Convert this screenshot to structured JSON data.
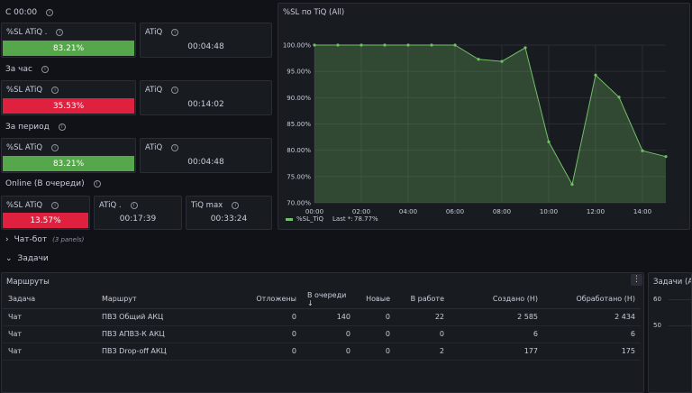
{
  "sections": {
    "since_midnight": "С 00:00",
    "per_hour": "За час",
    "per_period": "За период",
    "online": "Online (В очереди)"
  },
  "stats": {
    "midnight": {
      "sl_title": "%SL ATiQ .",
      "sl_value": "83.21%",
      "atiq_title": "ATiQ",
      "atiq_value": "00:04:48"
    },
    "hour": {
      "sl_title": "%SL ATiQ",
      "sl_value": "35.53%",
      "atiq_title": "ATiQ",
      "atiq_value": "00:14:02"
    },
    "period": {
      "sl_title": "%SL ATiQ",
      "sl_value": "83.21%",
      "atiq_title": "ATiQ",
      "atiq_value": "00:04:48"
    },
    "online": {
      "sl_title": "%SL ATiQ",
      "sl_value": "13.57%",
      "atiq_title": "ATiQ .",
      "atiq_value": "00:17:39",
      "tiq_title": "TiQ max",
      "tiq_value": "00:33:24"
    }
  },
  "colors": {
    "green": "#56a64b",
    "red": "#e0203f",
    "line": "#73bf69"
  },
  "chart_panel_title": "%SL по TiQ (All)",
  "chart_data": {
    "type": "area",
    "x": [
      "00:00",
      "00:30",
      "01:00",
      "01:30",
      "02:00",
      "02:30",
      "03:00",
      "03:30",
      "04:00",
      "04:30",
      "05:00",
      "05:30",
      "06:00",
      "06:30",
      "07:00",
      "07:30",
      "08:00",
      "08:30",
      "09:00",
      "09:30",
      "10:00",
      "10:30",
      "11:00",
      "11:30",
      "12:00",
      "12:30",
      "13:00",
      "13:30",
      "14:00",
      "14:30",
      "15:00"
    ],
    "series": [
      {
        "name": "%SL_TiQ",
        "values": [
          100,
          null,
          100,
          null,
          100,
          null,
          100,
          null,
          100,
          null,
          100,
          null,
          100,
          null,
          97.3,
          null,
          96.9,
          null,
          99.5,
          null,
          81.6,
          null,
          73.5,
          null,
          94.3,
          null,
          90.1,
          null,
          79.9,
          null,
          78.8
        ]
      }
    ],
    "xticks": [
      "00:00",
      "02:00",
      "04:00",
      "06:00",
      "08:00",
      "10:00",
      "12:00",
      "14:00"
    ],
    "yticks": [
      "100.00%",
      "95.00%",
      "90.00%",
      "85.00%",
      "80.00%",
      "75.00%",
      "70.00%"
    ],
    "ylim": [
      70,
      100
    ],
    "legend": {
      "label": "%SL_TiQ",
      "last_label": "Last *:",
      "last_value": "78.77%"
    }
  },
  "rows": {
    "chatbot": {
      "label": "Чат-бот",
      "sub": "(3 panels)"
    },
    "tasks": {
      "label": "Задачи"
    }
  },
  "routes_panel": {
    "title": "Маршруты",
    "columns": [
      "Задача",
      "Маршрут",
      "Отложены",
      "В очереди",
      "Новые",
      "В работе",
      "Создано (Н)",
      "Обработано (Н)"
    ],
    "sort_arrow": "↓",
    "rows": [
      [
        "Чат",
        "ПВЗ Общий АКЦ",
        "0",
        "140",
        "0",
        "22",
        "2 585",
        "2 434"
      ],
      [
        "Чат",
        "ПВЗ АПВЗ-К АКЦ",
        "0",
        "0",
        "0",
        "0",
        "6",
        "6"
      ],
      [
        "Чат",
        "ПВЗ Drop-off АКЦ",
        "0",
        "0",
        "0",
        "2",
        "177",
        "175"
      ]
    ]
  },
  "tasks_panel": {
    "title": "Задачи (All",
    "yticks": [
      "60",
      "50"
    ]
  }
}
